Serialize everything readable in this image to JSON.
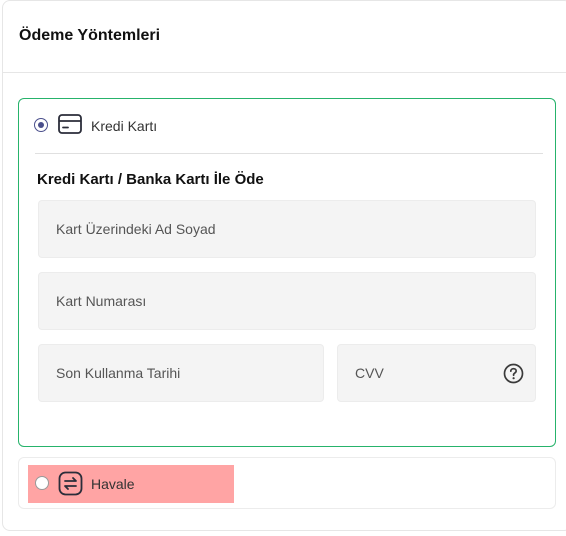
{
  "panel": {
    "title": "Ödeme Yöntemleri"
  },
  "methods": [
    {
      "label": "Kredi Kartı",
      "icon": "credit-card-icon",
      "selected": true
    },
    {
      "label": "Havale",
      "icon": "transfer-icon",
      "selected": false
    }
  ],
  "card_form": {
    "title": "Kredi Kartı / Banka Kartı İle Öde",
    "name_placeholder": "Kart Üzerindeki Ad Soyad",
    "number_placeholder": "Kart Numarası",
    "expiry_placeholder": "Son Kullanma Tarihi",
    "cvv_placeholder": "CVV",
    "cvv_help_icon": "question-circle-icon"
  },
  "colors": {
    "selected_border": "#26b36b",
    "radio_accent": "#4a4f8c",
    "field_bg": "#f4f4f4",
    "highlight": "#ffa4a4"
  }
}
